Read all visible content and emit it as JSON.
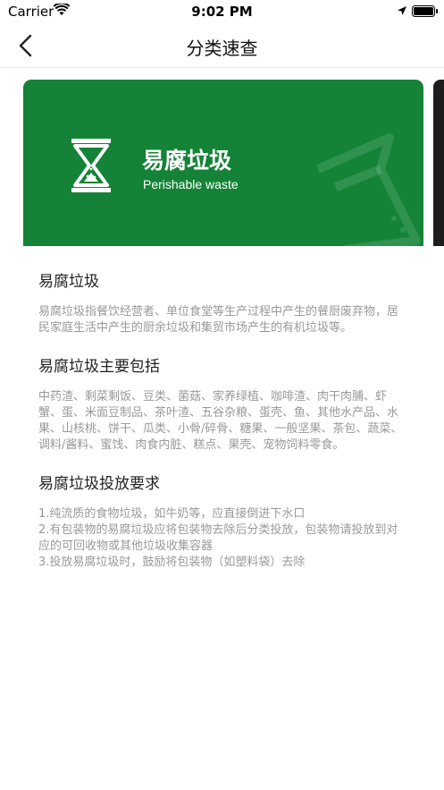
{
  "status_bar": {
    "carrier": "Carrier",
    "time": "9:02 PM",
    "wifi_icon": "wifi-icon",
    "location_icon": "location-arrow-icon",
    "battery_icon": "battery-icon"
  },
  "nav": {
    "title": "分类速查",
    "back_icon": "chevron-left-icon"
  },
  "banner": {
    "title": "易腐垃圾",
    "subtitle": "Perishable waste",
    "background": "#148337",
    "logo_icon": "hourglass-waste-icon"
  },
  "sections": [
    {
      "title": "易腐垃圾",
      "body": "易腐垃圾指餐饮经营者、单位食堂等生产过程中产生的餐厨废弃物，居民家庭生活中产生的厨余垃圾和集贸市场产生的有机垃圾等。"
    },
    {
      "title": "易腐垃圾主要包括",
      "body": "中药渣、剩菜剩饭、豆类、菌菇、家养绿植、咖啡渣、肉干肉脯、虾蟹、蛋、米面豆制品、茶叶渣、五谷杂粮、蛋壳、鱼、其他水产品、水果、山核桃、饼干、瓜类、小骨/碎骨、糖果、一般坚果、茶包、蔬菜、调料/酱料、蜜饯、肉食内脏、糕点、果壳、宠物饲料零食。"
    },
    {
      "title": "易腐垃圾投放要求",
      "body": "1.纯流质的食物垃圾，如牛奶等，应直接倒进下水口\n2.有包装物的易腐垃圾应将包装物去除后分类投放，包装物请投放到对应的可回收物或其他垃圾收集容器\n3.投放易腐垃圾时，鼓励将包装物（如塑料袋）去除"
    }
  ]
}
